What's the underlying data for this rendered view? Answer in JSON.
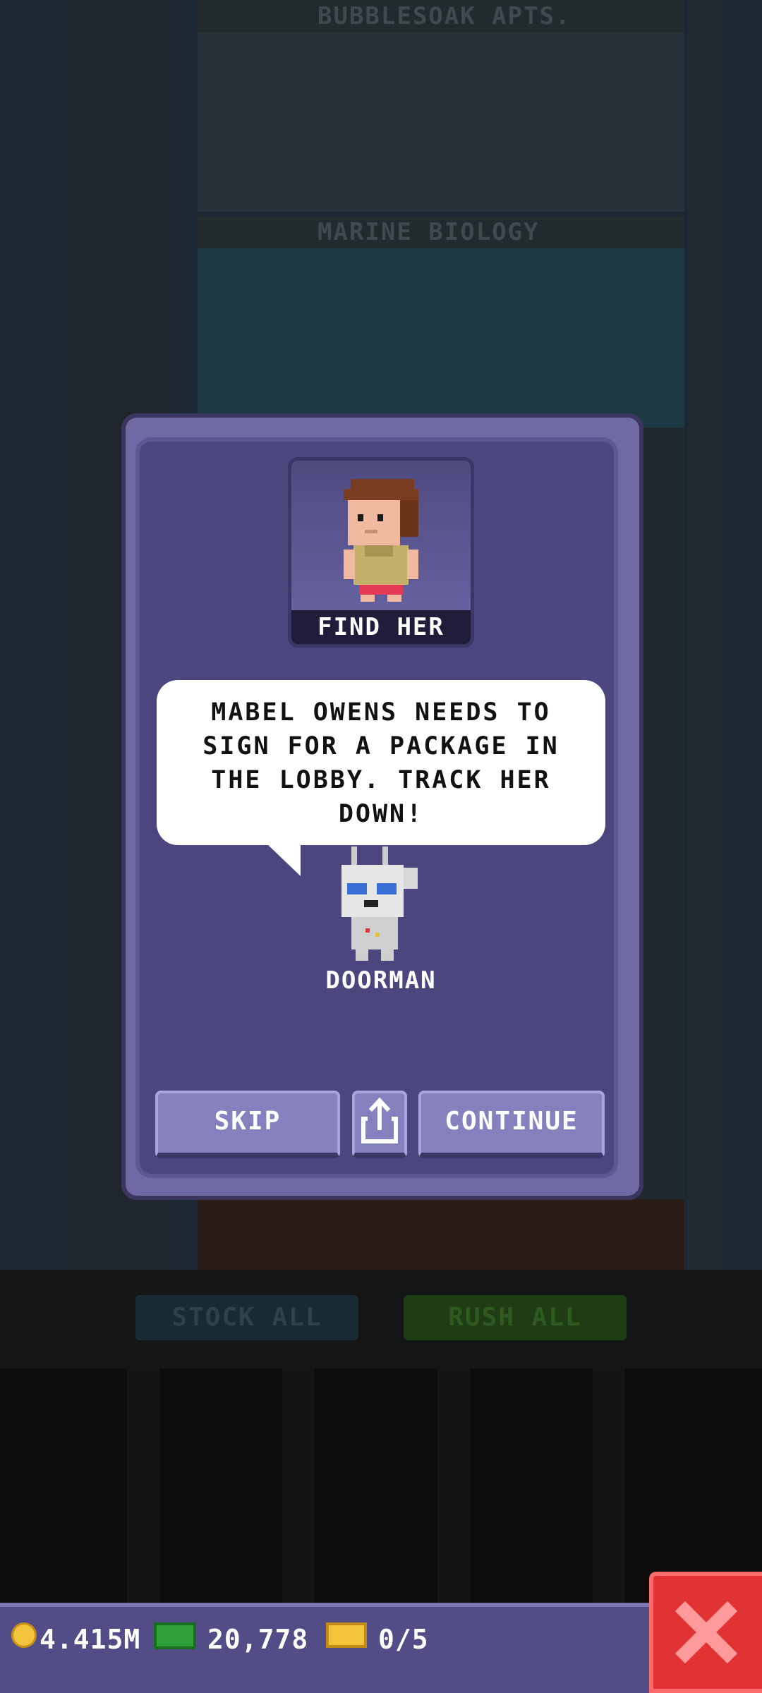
{
  "floors": [
    {
      "title": "BUBBLESOAK APTS.",
      "color": "#253038"
    },
    {
      "title": "MARINE BIOLOGY",
      "color": "#1d3a44"
    }
  ],
  "tower_buttons": {
    "stock_all": "STOCK ALL",
    "rush_all": "RUSH ALL"
  },
  "mission": {
    "portrait_label": "FIND HER",
    "message": "MABEL OWENS NEEDS TO SIGN FOR A PACKAGE IN THE LOBBY. TRACK HER DOWN!",
    "speaker": "DOORMAN"
  },
  "buttons": {
    "skip": "SKIP",
    "continue": "CONTINUE",
    "share_icon": "share-icon"
  },
  "status": {
    "coins": "4.415M",
    "bux": "20,778",
    "tickets": "0/5"
  },
  "colors": {
    "modal_bg": "#4b467e",
    "button": "#8581bf",
    "close": "#e13234"
  }
}
